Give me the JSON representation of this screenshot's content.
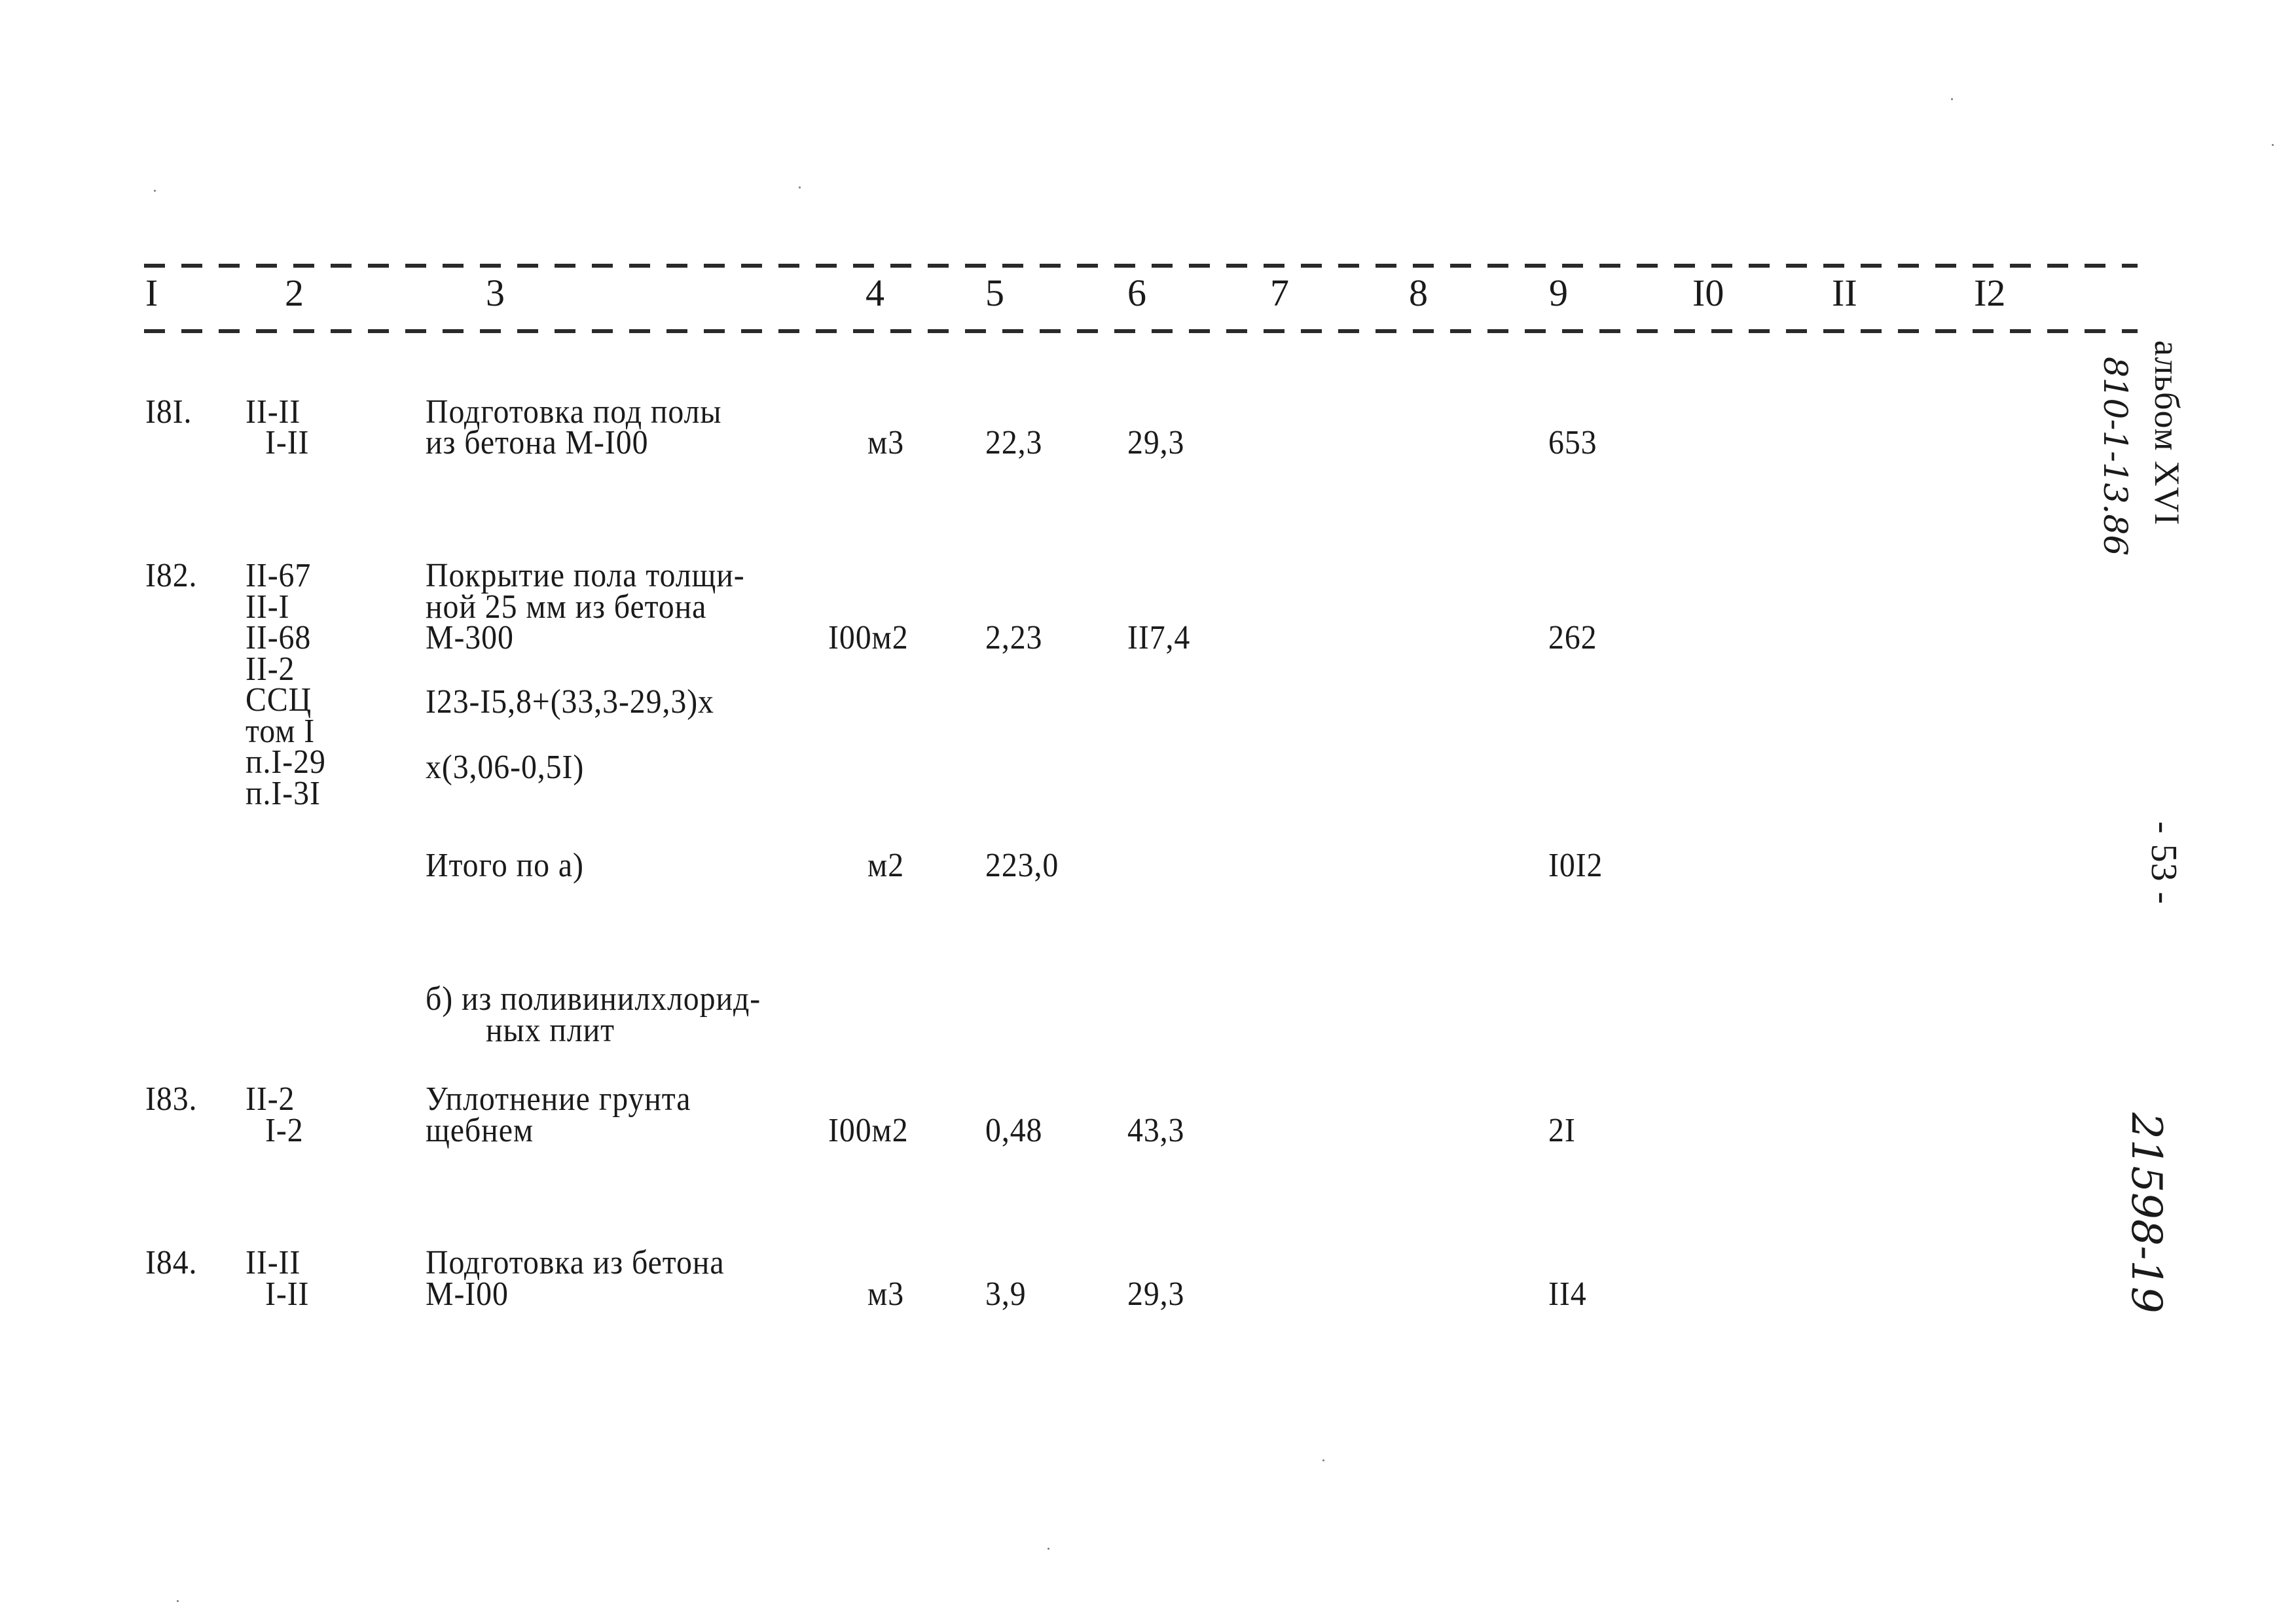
{
  "header": {
    "columns": [
      "I",
      "2",
      "3",
      "4",
      "5",
      "6",
      "7",
      "8",
      "9",
      "I0",
      "II",
      "I2"
    ]
  },
  "rows": [
    {
      "num": "I8I.",
      "codes": [
        "II-II",
        "I-II"
      ],
      "desc": [
        "Подготовка под полы",
        "из бетона М-I00"
      ],
      "unit": "м3",
      "qty": "22,3",
      "price": "29,3",
      "total": "653"
    },
    {
      "num": "I82.",
      "codes": [
        "II-67",
        "II-I",
        "II-68",
        "II-2",
        "ССЦ",
        "том I",
        "п.I-29",
        "п.I-3I"
      ],
      "desc": [
        "Покрытие пола толщи-",
        "ной 25 мм из бетона",
        "М-300"
      ],
      "formula": [
        "I23-I5,8+(33,3-29,3)х",
        "х(3,06-0,5I)"
      ],
      "unit": "I00м2",
      "qty": "2,23",
      "price": "II7,4",
      "total": "262"
    },
    {
      "subtotal_label": "Итого по а)",
      "unit": "м2",
      "qty": "223,0",
      "total": "I0I2"
    },
    {
      "section": [
        "б) из поливинилхлорид-",
        "ных плит"
      ]
    },
    {
      "num": "I83.",
      "codes": [
        "II-2",
        "I-2"
      ],
      "desc": [
        "Уплотнение грунта",
        "щебнем"
      ],
      "unit": "I00м2",
      "qty": "0,48",
      "price": "43,3",
      "total": "2I"
    },
    {
      "num": "I84.",
      "codes": [
        "II-II",
        "I-II"
      ],
      "desc": [
        "Подготовка из бетона",
        "М-I00"
      ],
      "unit": "м3",
      "qty": "3,9",
      "price": "29,3",
      "total": "II4"
    }
  ],
  "margin": {
    "album": "альбом XVI",
    "album_handwritten": "810-1-13.86",
    "page_number": "- 53 -",
    "doc_number": "21598-19"
  }
}
